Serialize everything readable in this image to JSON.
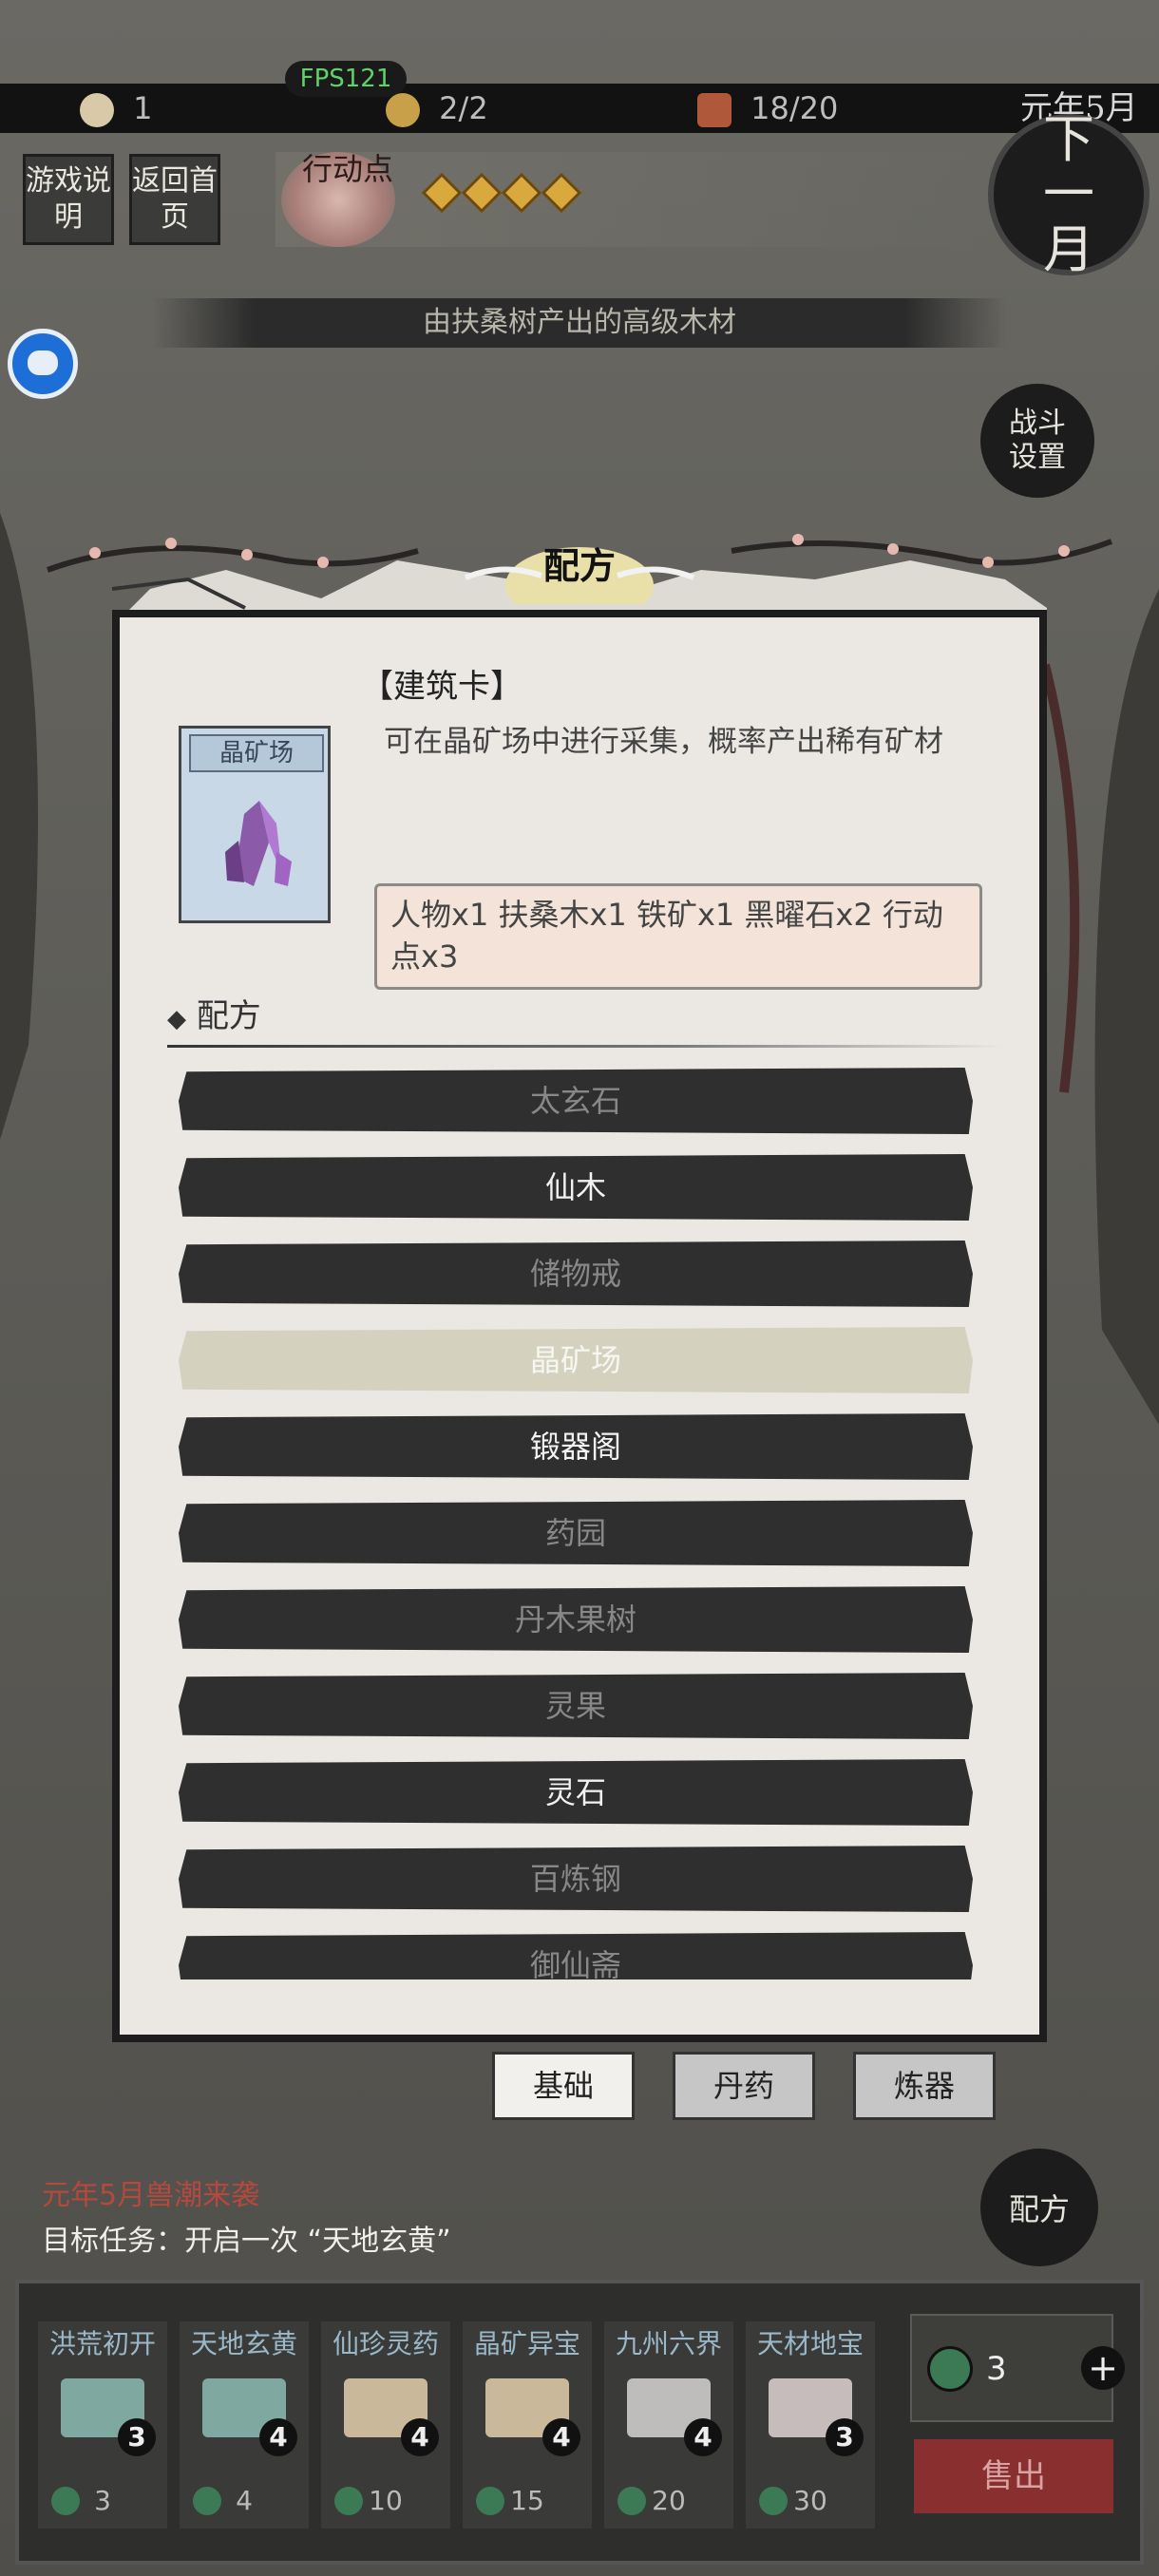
{
  "status": {
    "fps": "FPS121",
    "people_count": "1",
    "food": "2/2",
    "cards": "18/20",
    "date": "元年5月"
  },
  "buttons": {
    "help": "游戏说明",
    "home": "返回首页",
    "next_month": "下一月",
    "battle_settings": "战斗设置",
    "recipe": "配方"
  },
  "action_points": {
    "label": "行动点",
    "count": 4
  },
  "hint": "由扶桑树产出的高级木材",
  "modal": {
    "title": "配方",
    "card_name": "晶矿场",
    "card_kind": "【建筑卡】",
    "card_desc": "可在晶矿场中进行采集，概率产出稀有矿材",
    "requirements": "人物x1 扶桑木x1 铁矿x1 黑曜石x2 行动点x3",
    "section": "配方",
    "recipes": [
      {
        "label": "太玄石",
        "state": "dim"
      },
      {
        "label": "仙木",
        "state": "bright"
      },
      {
        "label": "储物戒",
        "state": "dim"
      },
      {
        "label": "晶矿场",
        "state": "selected"
      },
      {
        "label": "锻器阁",
        "state": "bright"
      },
      {
        "label": "药园",
        "state": "dim"
      },
      {
        "label": "丹木果树",
        "state": "dim"
      },
      {
        "label": "灵果",
        "state": "dim"
      },
      {
        "label": "灵石",
        "state": "bright"
      },
      {
        "label": "百炼钢",
        "state": "dim"
      },
      {
        "label": "御仙斋",
        "state": "dim"
      }
    ],
    "tabs": [
      "基础",
      "丹药",
      "炼器"
    ],
    "active_tab": "基础"
  },
  "events": {
    "alert": "元年5月兽潮来袭",
    "task": "目标任务：开启一次 “天地玄黄”"
  },
  "packs": [
    {
      "name": "洪荒初开",
      "count": "3",
      "cost": "3",
      "color": "#7fa8a0"
    },
    {
      "name": "天地玄黄",
      "count": "4",
      "cost": "4",
      "color": "#7fa8a0"
    },
    {
      "name": "仙珍灵药",
      "count": "4",
      "cost": "10",
      "color": "#c9b89a"
    },
    {
      "name": "晶矿异宝",
      "count": "4",
      "cost": "15",
      "color": "#c9b89a"
    },
    {
      "name": "九州六界",
      "count": "4",
      "cost": "20",
      "color": "#bfbcbc"
    },
    {
      "name": "天材地宝",
      "count": "3",
      "cost": "30",
      "color": "#c7bcbc"
    }
  ],
  "spirit_stones": "3",
  "sell": "售出"
}
